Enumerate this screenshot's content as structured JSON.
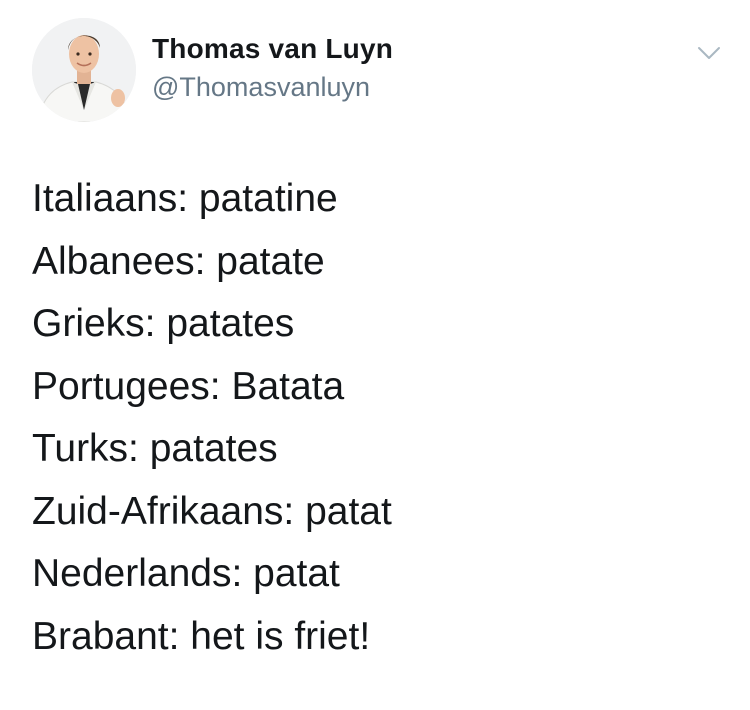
{
  "tweet": {
    "author": {
      "display_name": "Thomas van Luyn",
      "handle": "@Thomasvanluyn"
    },
    "menu_icon": "chevron-down-icon",
    "lines": [
      "Italiaans: patatine",
      "Albanees: patate",
      "Grieks: patates",
      "Portugees: Batata",
      "Turks: patates",
      "Zuid-Afrikaans: patat",
      "Nederlands: patat",
      "Brabant: het is friet!"
    ]
  },
  "colors": {
    "text": "#14171a",
    "secondary_text": "#657786",
    "chevron": "#aab8c2",
    "background": "#ffffff"
  }
}
